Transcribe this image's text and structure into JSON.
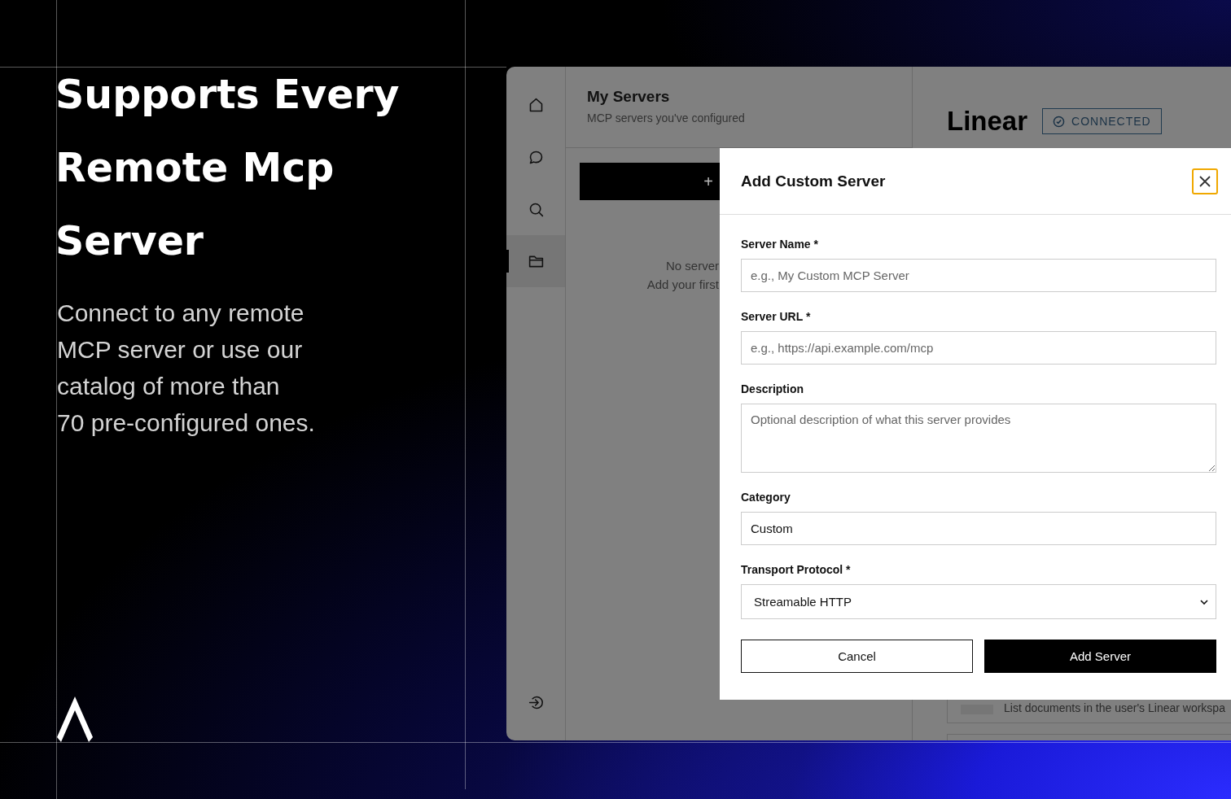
{
  "hero": {
    "heading": "Supports Every Remote Mcp Server",
    "description_lines": [
      "Connect to any remote",
      "MCP server or use our",
      "catalog of more than",
      "70 pre-configured ones."
    ]
  },
  "app": {
    "nav": [
      {
        "kind": "home",
        "selected": false
      },
      {
        "kind": "chat",
        "selected": false
      },
      {
        "kind": "search",
        "selected": false
      },
      {
        "kind": "folder",
        "selected": true
      }
    ],
    "servers_panel": {
      "title": "My Servers",
      "subtitle": "MCP servers you've configured",
      "add_button": "+",
      "empty_lines": [
        "No server",
        "Add your first"
      ]
    },
    "detail": {
      "title": "Linear",
      "status": "CONNECTED",
      "tool_description": "List documents in the user's Linear workspa"
    },
    "modal": {
      "title": "Add Custom Server",
      "fields": [
        {
          "kind": "input",
          "label": "Server Name *",
          "placeholder": "e.g., My Custom MCP Server"
        },
        {
          "kind": "input",
          "label": "Server URL *",
          "placeholder": "e.g., https://api.example.com/mcp"
        },
        {
          "kind": "textarea",
          "label": "Description",
          "placeholder": "Optional description of what this server provides"
        },
        {
          "kind": "input",
          "label": "Category",
          "value": "Custom"
        },
        {
          "kind": "select",
          "label": "Transport Protocol *",
          "value": "Streamable HTTP"
        }
      ],
      "buttons": [
        {
          "label": "Cancel",
          "kind": "secondary"
        },
        {
          "label": "Add Server",
          "kind": "primary"
        }
      ]
    }
  }
}
